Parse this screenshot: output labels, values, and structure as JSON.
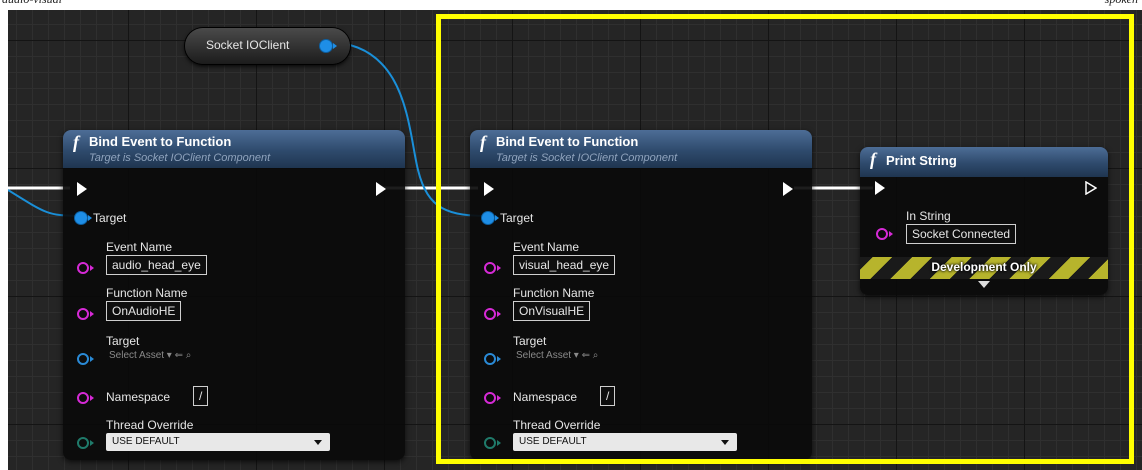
{
  "page": {
    "left_caption": "audio-visual",
    "right_caption": "spoken"
  },
  "var_node": {
    "label": "Socket IOClient"
  },
  "nodes": [
    {
      "title": "Bind Event to Function",
      "subtitle": "Target is Socket IOClient Component",
      "fn_glyph": "f",
      "target_label": "Target",
      "event_name_label": "Event Name",
      "event_name_value": "audio_head_eye",
      "function_name_label": "Function Name",
      "function_name_value": "OnAudioHE",
      "target2_label": "Target",
      "select_asset": "Select Asset ▾  ⇐ ⌕",
      "namespace_label": "Namespace",
      "namespace_value": "/",
      "thread_override_label": "Thread Override",
      "thread_override_value": "USE DEFAULT"
    },
    {
      "title": "Bind Event to Function",
      "subtitle": "Target is Socket IOClient Component",
      "fn_glyph": "f",
      "target_label": "Target",
      "event_name_label": "Event Name",
      "event_name_value": "visual_head_eye",
      "function_name_label": "Function Name",
      "function_name_value": "OnVisualHE",
      "target2_label": "Target",
      "select_asset": "Select Asset ▾  ⇐ ⌕",
      "namespace_label": "Namespace",
      "namespace_value": "/",
      "thread_override_label": "Thread Override",
      "thread_override_value": "USE DEFAULT"
    }
  ],
  "print_node": {
    "title": "Print String",
    "fn_glyph": "f",
    "in_string_label": "In String",
    "in_string_value": "Socket Connected",
    "dev_only_label": "Development Only"
  },
  "colors": {
    "selection": "#ffff00",
    "object_pin": "#1e8ee6",
    "string_pin": "#d62ad6",
    "header": "#2e4a6c"
  }
}
